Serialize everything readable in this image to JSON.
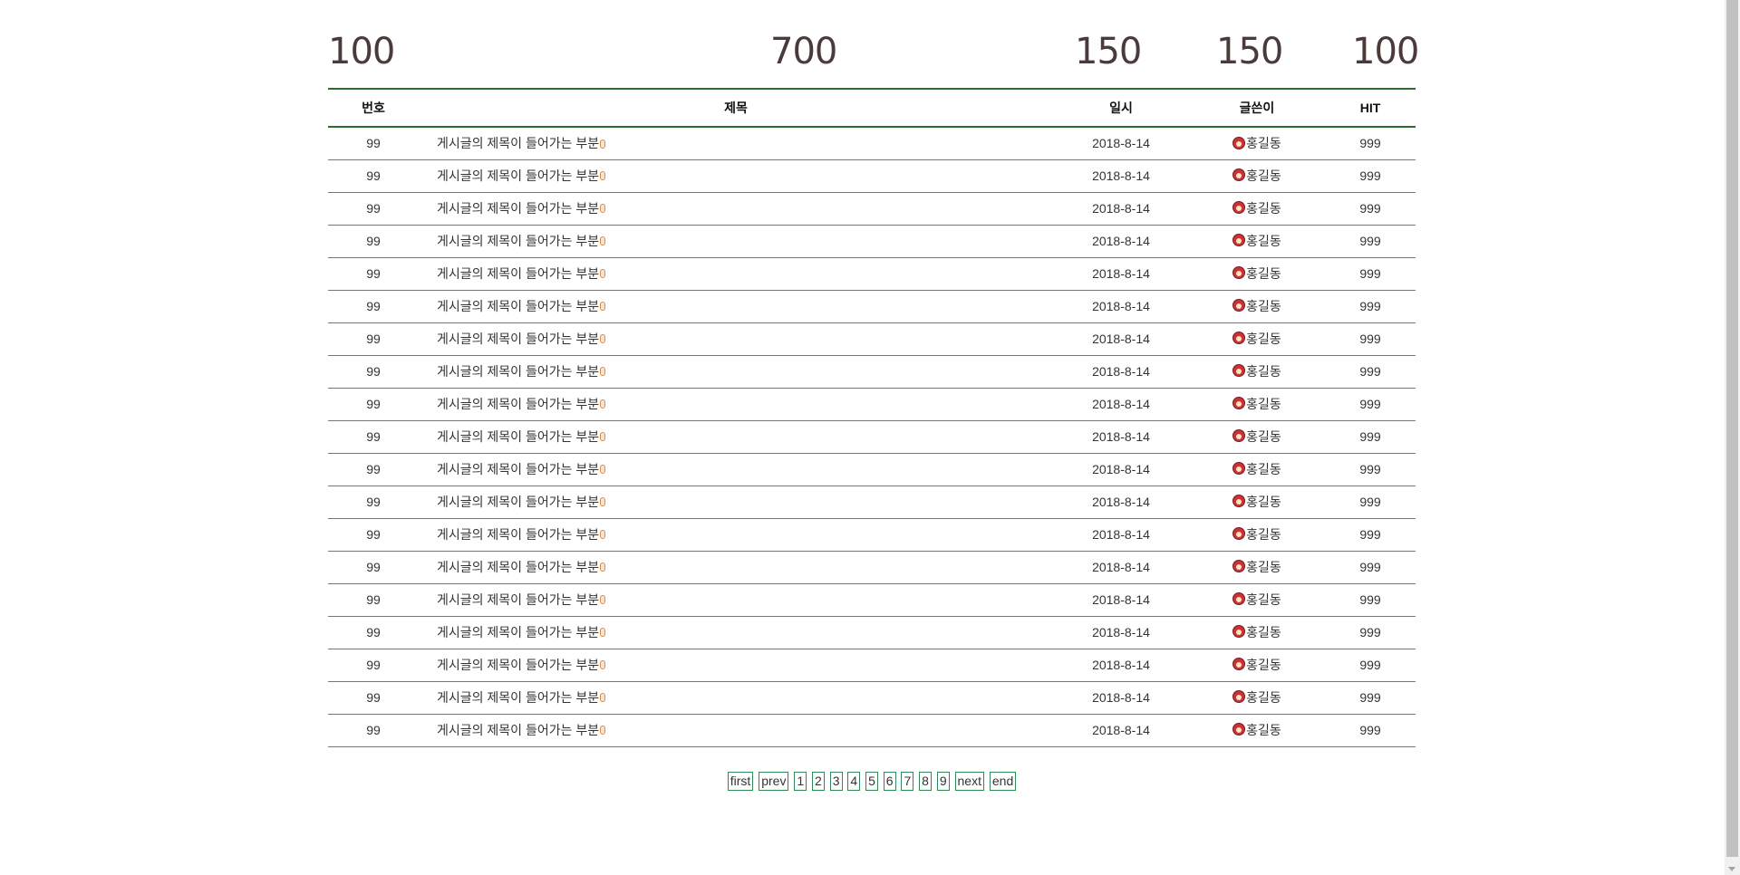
{
  "column_widths": [
    "100",
    "700",
    "150",
    "150",
    "100"
  ],
  "table": {
    "headers": [
      "번호",
      "제목",
      "일시",
      "글쓴이",
      "HIT"
    ],
    "rows": [
      {
        "num": "99",
        "title": "게시글의 제목이 들어가는 부분",
        "date": "2018-8-14",
        "author": "홍길동",
        "hit": "999"
      },
      {
        "num": "99",
        "title": "게시글의 제목이 들어가는 부분",
        "date": "2018-8-14",
        "author": "홍길동",
        "hit": "999"
      },
      {
        "num": "99",
        "title": "게시글의 제목이 들어가는 부분",
        "date": "2018-8-14",
        "author": "홍길동",
        "hit": "999"
      },
      {
        "num": "99",
        "title": "게시글의 제목이 들어가는 부분",
        "date": "2018-8-14",
        "author": "홍길동",
        "hit": "999"
      },
      {
        "num": "99",
        "title": "게시글의 제목이 들어가는 부분",
        "date": "2018-8-14",
        "author": "홍길동",
        "hit": "999"
      },
      {
        "num": "99",
        "title": "게시글의 제목이 들어가는 부분",
        "date": "2018-8-14",
        "author": "홍길동",
        "hit": "999"
      },
      {
        "num": "99",
        "title": "게시글의 제목이 들어가는 부분",
        "date": "2018-8-14",
        "author": "홍길동",
        "hit": "999"
      },
      {
        "num": "99",
        "title": "게시글의 제목이 들어가는 부분",
        "date": "2018-8-14",
        "author": "홍길동",
        "hit": "999"
      },
      {
        "num": "99",
        "title": "게시글의 제목이 들어가는 부분",
        "date": "2018-8-14",
        "author": "홍길동",
        "hit": "999"
      },
      {
        "num": "99",
        "title": "게시글의 제목이 들어가는 부분",
        "date": "2018-8-14",
        "author": "홍길동",
        "hit": "999"
      },
      {
        "num": "99",
        "title": "게시글의 제목이 들어가는 부분",
        "date": "2018-8-14",
        "author": "홍길동",
        "hit": "999"
      },
      {
        "num": "99",
        "title": "게시글의 제목이 들어가는 부분",
        "date": "2018-8-14",
        "author": "홍길동",
        "hit": "999"
      },
      {
        "num": "99",
        "title": "게시글의 제목이 들어가는 부분",
        "date": "2018-8-14",
        "author": "홍길동",
        "hit": "999"
      },
      {
        "num": "99",
        "title": "게시글의 제목이 들어가는 부분",
        "date": "2018-8-14",
        "author": "홍길동",
        "hit": "999"
      },
      {
        "num": "99",
        "title": "게시글의 제목이 들어가는 부분",
        "date": "2018-8-14",
        "author": "홍길동",
        "hit": "999"
      },
      {
        "num": "99",
        "title": "게시글의 제목이 들어가는 부분",
        "date": "2018-8-14",
        "author": "홍길동",
        "hit": "999"
      },
      {
        "num": "99",
        "title": "게시글의 제목이 들어가는 부분",
        "date": "2018-8-14",
        "author": "홍길동",
        "hit": "999"
      },
      {
        "num": "99",
        "title": "게시글의 제목이 들어가는 부분",
        "date": "2018-8-14",
        "author": "홍길동",
        "hit": "999"
      },
      {
        "num": "99",
        "title": "게시글의 제목이 들어가는 부분",
        "date": "2018-8-14",
        "author": "홍길동",
        "hit": "999"
      }
    ]
  },
  "pagination": {
    "first": "first",
    "prev": "prev",
    "pages": [
      "1",
      "2",
      "3",
      "4",
      "5",
      "6",
      "7",
      "8",
      "9"
    ],
    "next": "next",
    "end": "end"
  },
  "icons": {
    "title_suffix": "new-icon",
    "author_prefix": "avatar-icon"
  },
  "colors": {
    "accent": "#2e6b2e",
    "pager_border": "#2e8b57"
  }
}
